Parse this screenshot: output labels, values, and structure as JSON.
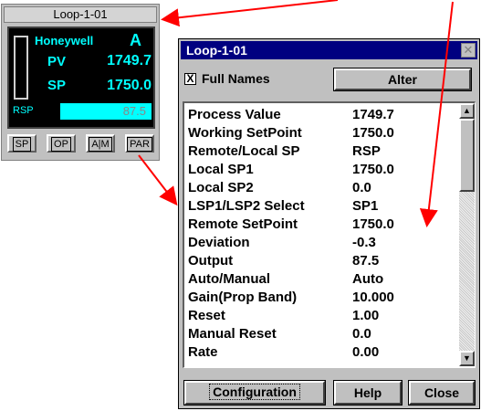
{
  "faceplate": {
    "title": "Loop-1-01",
    "brand": "Honeywell",
    "mode": "A",
    "pv_label": "PV",
    "pv_value": "1749.7",
    "sp_label": "SP",
    "sp_value": "1750.0",
    "rsp_label": "RSP",
    "output_value": "87.5",
    "buttons": [
      "SP",
      "OP",
      "A|M",
      "PAR"
    ]
  },
  "dialog": {
    "title": "Loop-1-01",
    "close_glyph": "✕",
    "full_names_checked": "X",
    "full_names_label": "Full Names",
    "alter_label": "Alter",
    "parameters": [
      {
        "name": "Process Value",
        "value": "1749.7"
      },
      {
        "name": "Working SetPoint",
        "value": "1750.0"
      },
      {
        "name": "Remote/Local SP",
        "value": "RSP"
      },
      {
        "name": "Local SP1",
        "value": "1750.0"
      },
      {
        "name": "Local SP2",
        "value": "0.0"
      },
      {
        "name": "LSP1/LSP2 Select",
        "value": "SP1"
      },
      {
        "name": "Remote SetPoint",
        "value": "1750.0"
      },
      {
        "name": "Deviation",
        "value": "-0.3"
      },
      {
        "name": "Output",
        "value": "87.5"
      },
      {
        "name": "Auto/Manual",
        "value": "Auto"
      },
      {
        "name": "Gain(Prop Band)",
        "value": "10.000"
      },
      {
        "name": "Reset",
        "value": "1.00"
      },
      {
        "name": "Manual Reset",
        "value": "0.0"
      },
      {
        "name": "Rate",
        "value": "0.00"
      }
    ],
    "configuration_label": "Configuration",
    "help_label": "Help",
    "close_label": "Close"
  },
  "colors": {
    "display_text": "#00ffff",
    "title_bar": "#000080",
    "arrow": "#ff0000"
  }
}
